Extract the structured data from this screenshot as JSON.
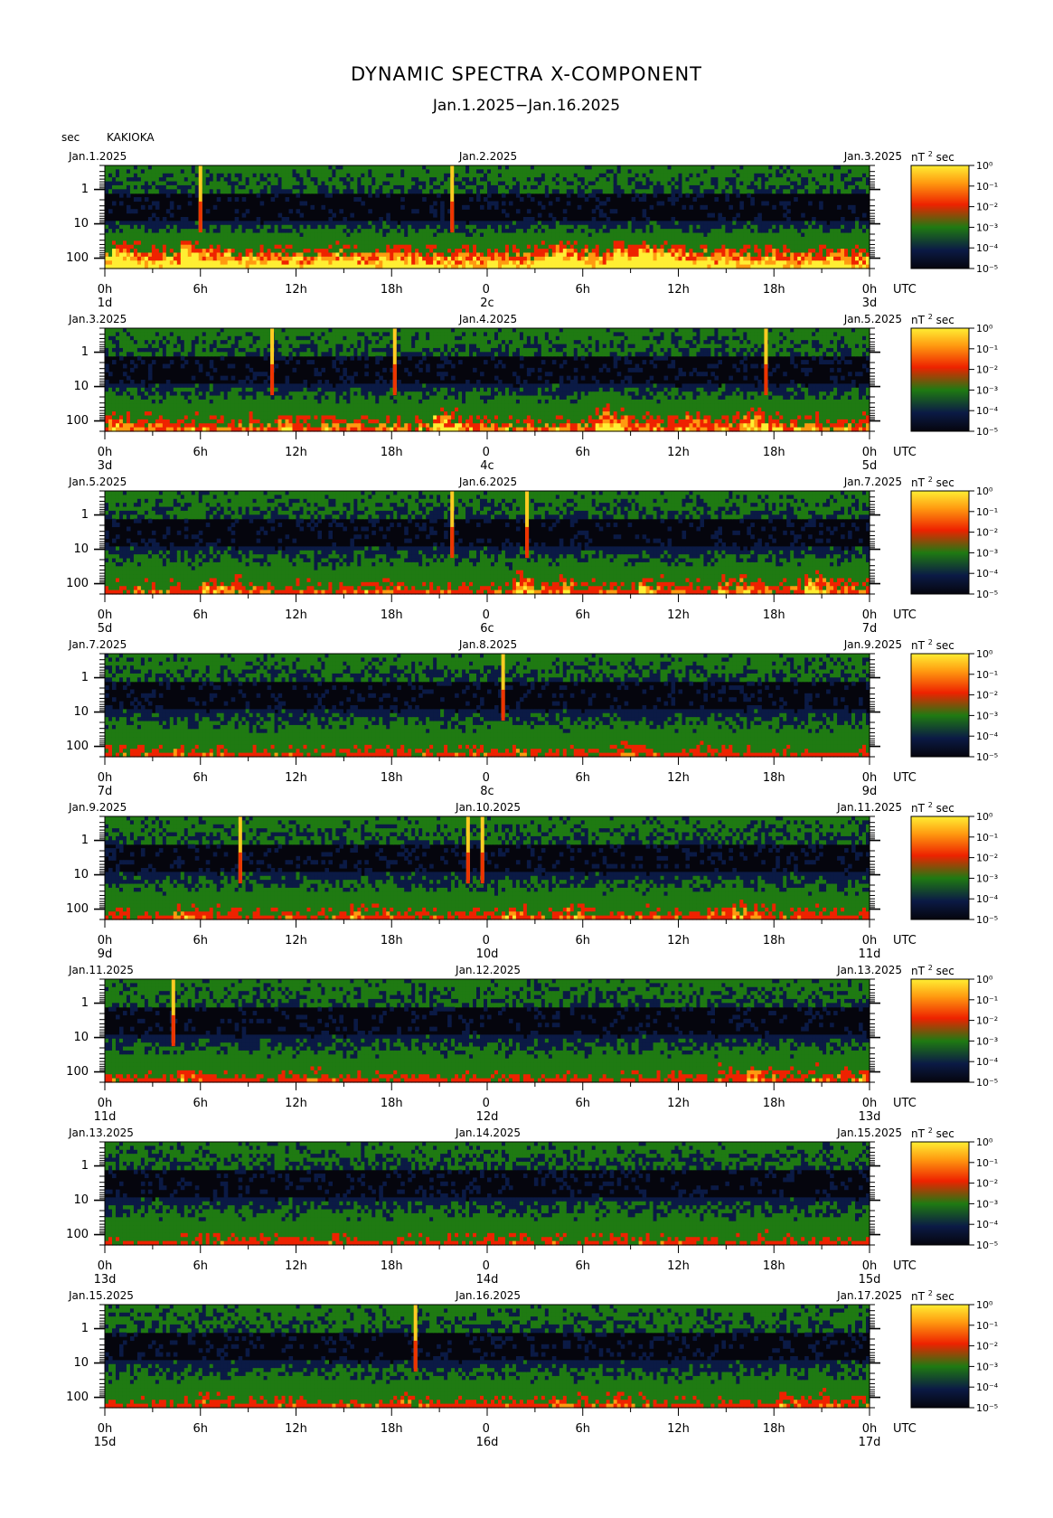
{
  "header": {
    "title": "DYNAMIC SPECTRA X-COMPONENT",
    "subtitle": "Jan.1.2025−Jan.16.2025",
    "y_unit": "sec",
    "station": "KAKIOKA"
  },
  "colorbar": {
    "unit_label": "nT",
    "unit_power": "2",
    "unit_suffix": "sec",
    "labels": [
      "10⁰",
      "10⁻¹",
      "10⁻²",
      "10⁻³",
      "10⁻⁴",
      "10⁻⁵"
    ],
    "colors": [
      "#ffee33",
      "#ff9a10",
      "#ee2200",
      "#1f7a12",
      "#0b1a45",
      "#05050d"
    ]
  },
  "chart_data": {
    "type": "heatmap",
    "x_unit": "UTC",
    "y_scale": "log",
    "y_ticks": [
      "1",
      "10",
      "100"
    ],
    "x_ticks_hours": [
      "0h",
      "6h",
      "12h",
      "18h",
      "0 ",
      "6h",
      "12h",
      "18h",
      "0h"
    ],
    "panels": [
      {
        "start_date": "Jan.1.2025",
        "mid_date": "Jan.2.2025",
        "end_date": "Jan.3.2025",
        "day_labels": [
          "1d",
          "2c",
          "3d"
        ],
        "bursts": [
          6.0,
          21.8
        ],
        "activity": 0.95
      },
      {
        "start_date": "Jan.3.2025",
        "mid_date": "Jan.4.2025",
        "end_date": "Jan.5.2025",
        "day_labels": [
          "3d",
          "4c",
          "5d"
        ],
        "bursts": [
          10.5,
          18.2,
          41.5
        ],
        "activity": 0.55
      },
      {
        "start_date": "Jan.5.2025",
        "mid_date": "Jan.6.2025",
        "end_date": "Jan.7.2025",
        "day_labels": [
          "5d",
          "6c",
          "7d"
        ],
        "bursts": [
          21.8,
          26.5
        ],
        "activity": 0.4
      },
      {
        "start_date": "Jan.7.2025",
        "mid_date": "Jan.8.2025",
        "end_date": "Jan.9.2025",
        "day_labels": [
          "7d",
          "8c",
          "9d"
        ],
        "bursts": [
          25.0
        ],
        "activity": 0.3
      },
      {
        "start_date": "Jan.9.2025",
        "mid_date": "Jan.10.2025",
        "end_date": "Jan.11.2025",
        "day_labels": [
          "9d",
          "10d",
          "11d"
        ],
        "bursts": [
          8.5,
          22.8,
          23.7
        ],
        "activity": 0.35
      },
      {
        "start_date": "Jan.11.2025",
        "mid_date": "Jan.12.2025",
        "end_date": "Jan.13.2025",
        "day_labels": [
          "11d",
          "12d",
          "13d"
        ],
        "bursts": [
          4.3
        ],
        "activity": 0.3
      },
      {
        "start_date": "Jan.13.2025",
        "mid_date": "Jan.14.2025",
        "end_date": "Jan.15.2025",
        "day_labels": [
          "13d",
          "14d",
          "15d"
        ],
        "bursts": [],
        "activity": 0.25
      },
      {
        "start_date": "Jan.15.2025",
        "mid_date": "Jan.16.2025",
        "end_date": "Jan.17.2025",
        "day_labels": [
          "15d",
          "16d",
          "17d"
        ],
        "bursts": [
          19.5
        ],
        "activity": 0.3
      }
    ]
  }
}
